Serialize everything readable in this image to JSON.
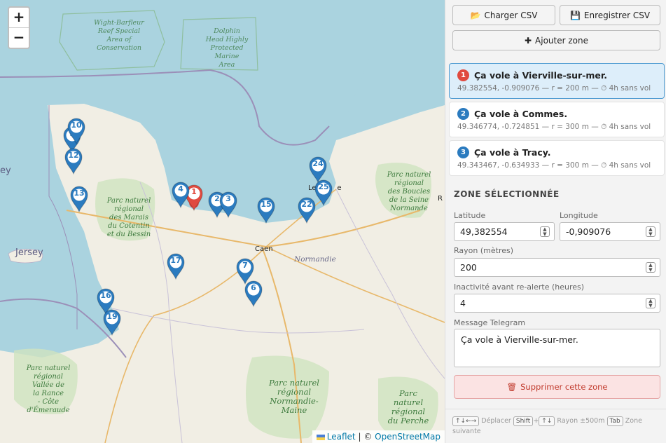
{
  "map": {
    "zoom_in": "+",
    "zoom_out": "−",
    "attribution": {
      "leaflet": "Leaflet",
      "sep": "|",
      "copy": "©",
      "osm": "OpenStreetMap"
    },
    "labels": {
      "wight": [
        "Wight-Barfleur",
        "Reef Special",
        "Area of",
        "Conservation"
      ],
      "dolphin": [
        "Dolphin",
        "Head Highly",
        "Protected",
        "Marine",
        "Area"
      ],
      "jersey": "Jersey",
      "ey": "ey",
      "cotentin": [
        "Parc naturel",
        "régional",
        "des Marais",
        "du Cotentin",
        "et du Bessin"
      ],
      "caen": "Caen",
      "normandie": "Normandie",
      "seine": [
        "Parc naturel",
        "régional",
        "des Boucles",
        "de la Seine",
        "Normande"
      ],
      "rance": [
        "Parc naturel",
        "régional",
        "Vallée de",
        "la Rance",
        "- Côte d'Émeraude"
      ],
      "maine": [
        "Parc naturel",
        "régional",
        "Normandie-",
        "Maine"
      ],
      "perche": [
        "Parc naturel",
        "régional",
        "du Perche"
      ],
      "le_havre": "Le H      e",
      "r_edge": "R"
    },
    "markers": [
      {
        "label": "1",
        "color": "#e04a3f",
        "active": true
      },
      {
        "label": "2",
        "color": "#2b7bbf"
      },
      {
        "label": "3",
        "color": "#2b7bbf"
      },
      {
        "label": "4",
        "color": "#2b7bbf"
      },
      {
        "label": "6",
        "color": "#2b7bbf"
      },
      {
        "label": "7",
        "color": "#2b7bbf"
      },
      {
        "label": "9",
        "color": "#2b7bbf"
      },
      {
        "label": "10",
        "color": "#2b7bbf"
      },
      {
        "label": "12",
        "color": "#2b7bbf"
      },
      {
        "label": "13",
        "color": "#2b7bbf"
      },
      {
        "label": "15",
        "color": "#2b7bbf"
      },
      {
        "label": "16",
        "color": "#2b7bbf"
      },
      {
        "label": "17",
        "color": "#2b7bbf"
      },
      {
        "label": "19",
        "color": "#2b7bbf"
      },
      {
        "label": "22",
        "color": "#2b7bbf"
      },
      {
        "label": "24",
        "color": "#2b7bbf"
      },
      {
        "label": "25",
        "color": "#2b7bbf"
      }
    ]
  },
  "toolbar": {
    "load_icon": "folder-icon",
    "load_label": "Charger CSV",
    "save_icon": "floppy-icon",
    "save_label": "Enregistrer CSV",
    "add_icon": "plus-icon",
    "add_label": "Ajouter zone"
  },
  "zones": [
    {
      "index": "1",
      "title": "Ça vole à Vierville-sur-mer.",
      "meta": "49.382554, -0.909076 — r = 200 m — ⏱ 4h sans vol",
      "badge_color": "#e04a3f",
      "selected": true
    },
    {
      "index": "2",
      "title": "Ça vole à Commes.",
      "meta": "49.346774, -0.724851 — r = 300 m — ⏱ 4h sans vol",
      "badge_color": "#2b7bbf"
    },
    {
      "index": "3",
      "title": "Ça vole à Tracy.",
      "meta": "49.343467, -0.634933 — r = 300 m — ⏱ 4h sans vol",
      "badge_color": "#2b7bbf"
    }
  ],
  "form": {
    "section_title": "ZONE SÉLECTIONNÉE",
    "latitude_label": "Latitude",
    "latitude_value": "49,382554",
    "longitude_label": "Longitude",
    "longitude_value": "-0,909076",
    "radius_label": "Rayon (mètres)",
    "radius_value": "200",
    "inactivity_label": "Inactivité avant re-alerte (heures)",
    "inactivity_value": "4",
    "message_label": "Message Telegram",
    "message_value": "Ça vole à Vierville-sur-mer.",
    "delete_icon": "trash-icon",
    "delete_label": "Supprimer cette zone"
  },
  "hints": {
    "move_keys": "↑↓←→",
    "move_label": "Déplacer",
    "shift_key": "Shift",
    "plus": "+",
    "radius_keys": "↑↓",
    "radius_label": "Rayon ±500m",
    "tab_key": "Tab",
    "tab_label": "Zone suivante"
  }
}
